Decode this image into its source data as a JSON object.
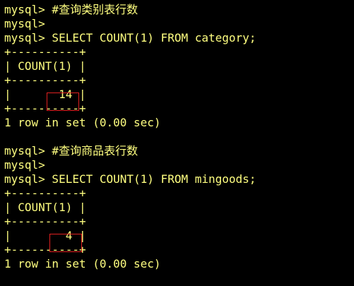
{
  "terminal": {
    "colors": {
      "background": "#000000",
      "text": "#ffff80",
      "highlight_box": "#e02020"
    },
    "lines": [
      "mysql> #查询类别表行数",
      "mysql>",
      "mysql> SELECT COUNT(1) FROM category;",
      "+----------+",
      "| COUNT(1) |",
      "+----------+",
      "|       14 |",
      "+----------+",
      "1 row in set (0.00 sec)",
      "",
      "mysql> #查询商品表行数",
      "mysql>",
      "mysql> SELECT COUNT(1) FROM mingoods;",
      "+----------+",
      "| COUNT(1) |",
      "+----------+",
      "|        4 |",
      "+----------+",
      "1 row in set (0.00 sec)"
    ]
  }
}
